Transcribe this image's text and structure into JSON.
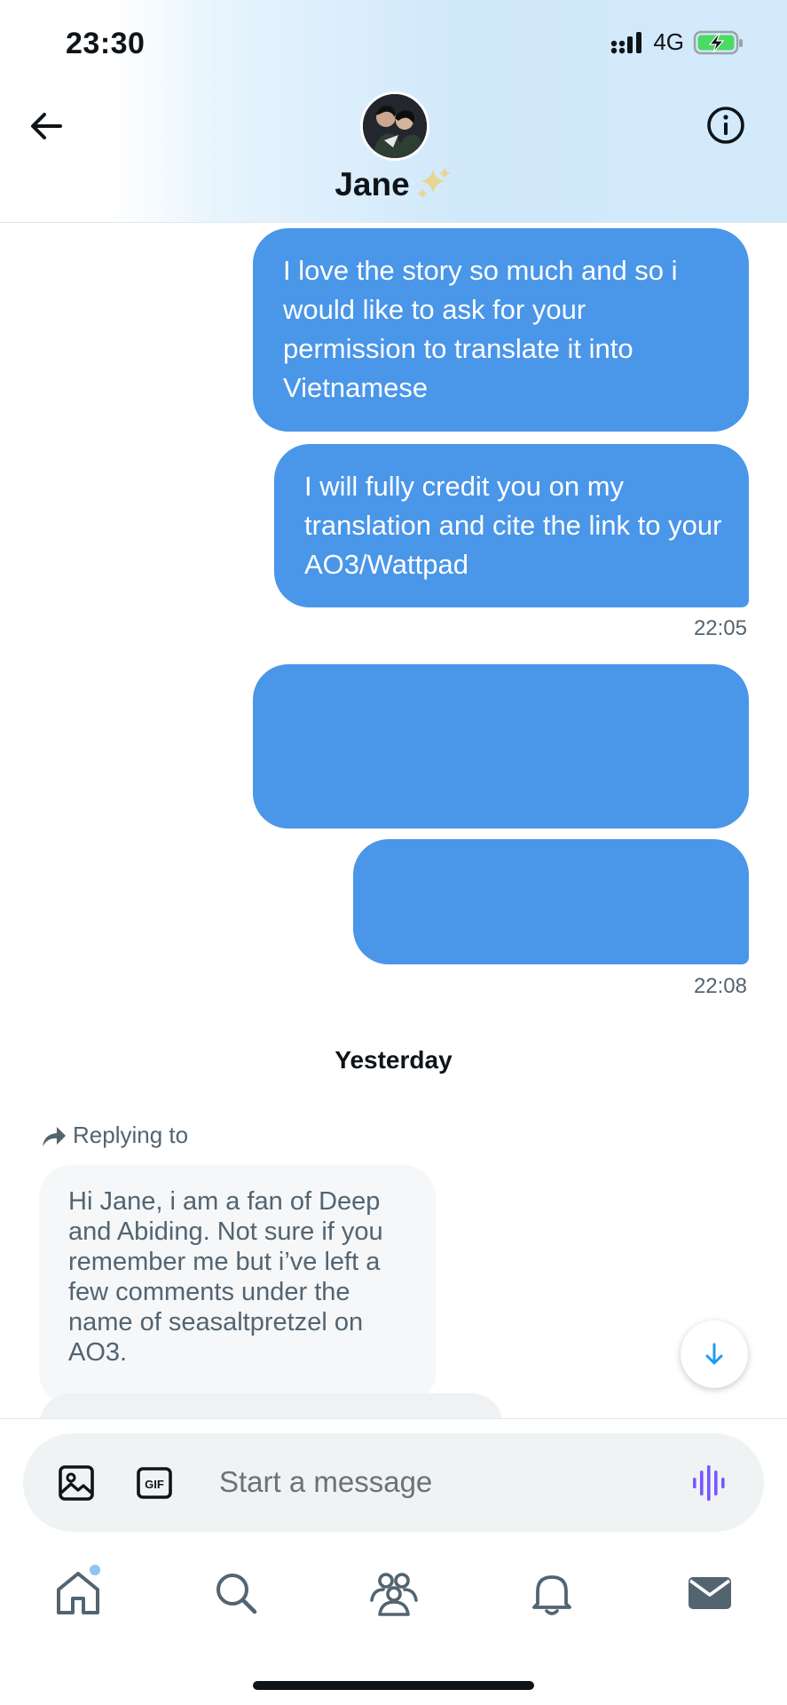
{
  "status_bar": {
    "time": "23:30",
    "network": "4G"
  },
  "header": {
    "contact_name": "Jane",
    "name_emoji": "✨"
  },
  "messages": {
    "out1": "I love the story so much and so i would like to ask for your permission to translate it into Vietnamese",
    "out2": "I will fully credit you on my translation and cite the link to your AO3/Wattpad",
    "timestamp1": "22:05",
    "timestamp2": "22:08",
    "day_divider": "Yesterday",
    "reply_label": "Replying to",
    "in_quoted": "Hi Jane, i am a fan of Deep and Abiding. Not sure if you remember me but i’ve left a few comments under the name of seasaltpretzel on AO3."
  },
  "composer": {
    "placeholder": "Start a message"
  },
  "colors": {
    "bubble_out": "#4a96e8",
    "accent": "#1d9bf0",
    "voice_icon": "#7856ff"
  },
  "icons": [
    "back-arrow-icon",
    "info-icon",
    "image-icon",
    "gif-icon",
    "voice-icon",
    "home-icon",
    "search-icon",
    "communities-icon",
    "notifications-icon",
    "messages-icon",
    "scroll-down-icon"
  ]
}
